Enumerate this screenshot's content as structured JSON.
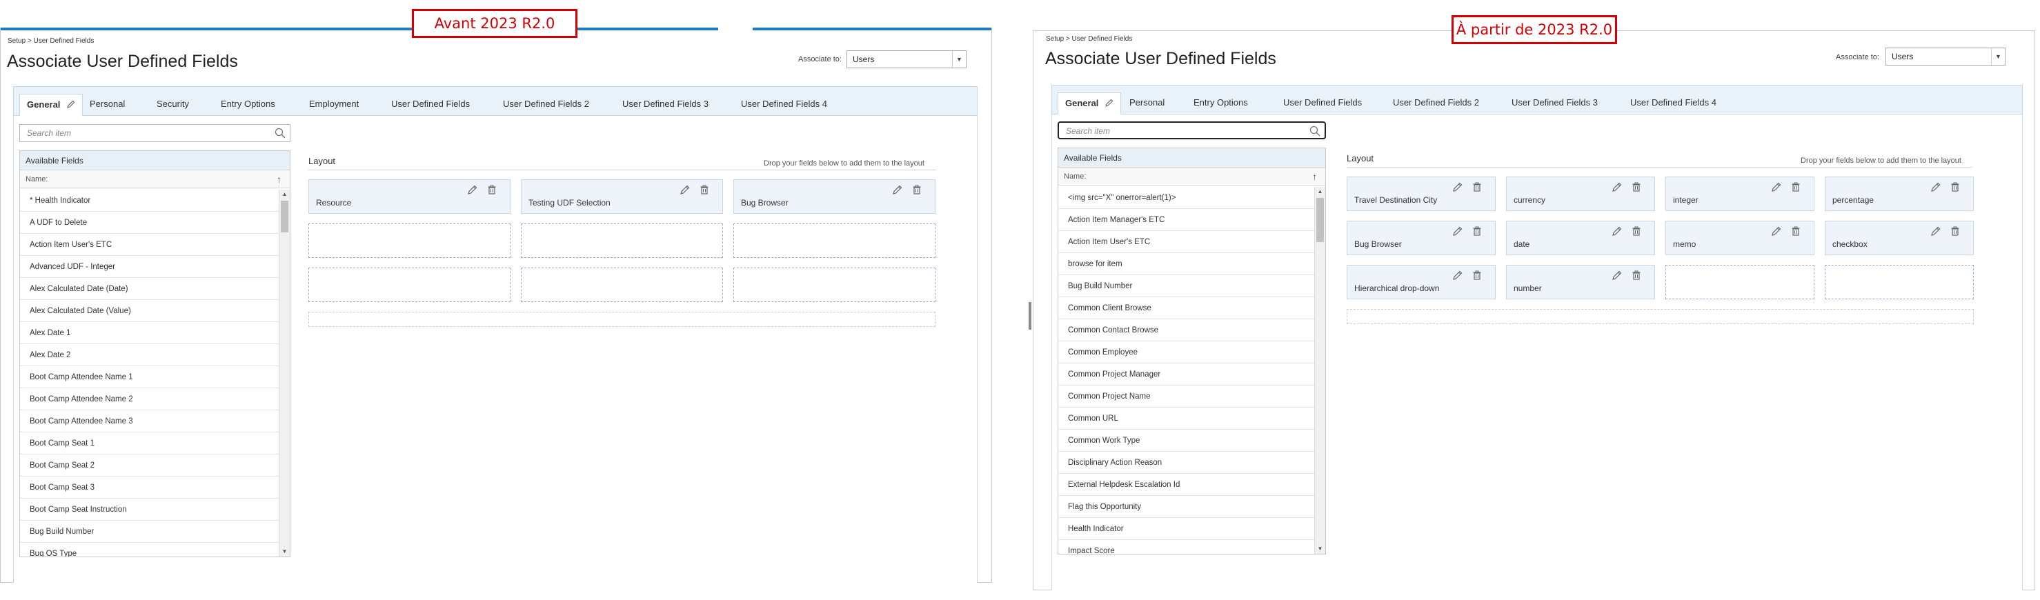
{
  "captions": {
    "before": "Avant 2023 R2.0",
    "after": "À partir de 2023 R2.0"
  },
  "colors": {
    "caption_border": "#d20000",
    "top_accent": "#1f7bc1",
    "tab_strip_bg": "#e9f2f8",
    "card_bg": "#eef4f9",
    "slot_border": "#93aeca"
  },
  "before": {
    "breadcrumb": "Setup > User Defined Fields",
    "title": "Associate User Defined Fields",
    "associate_label": "Associate to:",
    "associate_value": "Users",
    "tabs": [
      "General",
      "Personal",
      "Security",
      "Entry Options",
      "Employment",
      "User Defined Fields",
      "User Defined Fields 2",
      "User Defined Fields 3",
      "User Defined Fields 4"
    ],
    "search_placeholder": "Search item",
    "available_header": "Available Fields",
    "name_header": "Name:",
    "available_items": [
      "* Health Indicator",
      "A UDF to Delete",
      "Action Item User's ETC",
      "Advanced UDF - Integer",
      "Alex Calculated Date (Date)",
      "Alex Calculated Date (Value)",
      "Alex Date 1",
      "Alex Date 2",
      "Boot Camp Attendee Name 1",
      "Boot Camp Attendee Name 2",
      "Boot Camp Attendee Name 3",
      "Boot Camp Seat 1",
      "Boot Camp Seat 2",
      "Boot Camp Seat 3",
      "Boot Camp Seat Instruction",
      "Bug Build Number",
      "Bug OS Type"
    ],
    "layout_title": "Layout",
    "layout_hint": "Drop your fields below to add them to the layout",
    "layout_fields": [
      "Resource",
      "Testing UDF Selection",
      "Bug Browser"
    ]
  },
  "after": {
    "breadcrumb": "Setup > User Defined Fields",
    "title": "Associate User Defined Fields",
    "associate_label": "Associate to:",
    "associate_value": "Users",
    "tabs": [
      "General",
      "Personal",
      "Entry Options",
      "User Defined Fields",
      "User Defined Fields 2",
      "User Defined Fields 3",
      "User Defined Fields 4"
    ],
    "search_placeholder": "Search item",
    "available_header": "Available Fields",
    "name_header": "Name:",
    "available_items": [
      "<img src=\"X\" onerror=alert(1)>",
      "Action Item Manager's ETC",
      "Action Item User's ETC",
      "browse for item",
      "Bug Build Number",
      "Common Client Browse",
      "Common Contact Browse",
      "Common Employee",
      "Common Project Manager",
      "Common Project Name",
      "Common URL",
      "Common Work Type",
      "Disciplinary Action Reason",
      "External Helpdesk Escalation Id",
      "Flag this Opportunity",
      "Health Indicator",
      "Impact Score"
    ],
    "layout_title": "Layout",
    "layout_hint": "Drop your fields below to add them to the layout",
    "layout_fields": [
      "Travel Destination City",
      "currency",
      "integer",
      "percentage",
      "Bug Browser",
      "date",
      "memo",
      "checkbox",
      "Hierarchical drop-down",
      "number"
    ]
  }
}
